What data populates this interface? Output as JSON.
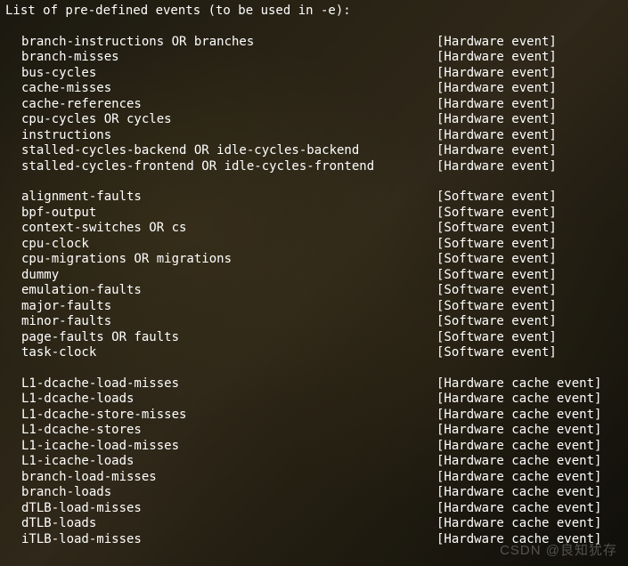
{
  "header": "List of pre-defined events (to be used in -e):",
  "groups": [
    {
      "type_label": "[Hardware event]",
      "events": [
        "branch-instructions OR branches",
        "branch-misses",
        "bus-cycles",
        "cache-misses",
        "cache-references",
        "cpu-cycles OR cycles",
        "instructions",
        "stalled-cycles-backend OR idle-cycles-backend",
        "stalled-cycles-frontend OR idle-cycles-frontend"
      ]
    },
    {
      "type_label": "[Software event]",
      "events": [
        "alignment-faults",
        "bpf-output",
        "context-switches OR cs",
        "cpu-clock",
        "cpu-migrations OR migrations",
        "dummy",
        "emulation-faults",
        "major-faults",
        "minor-faults",
        "page-faults OR faults",
        "task-clock"
      ]
    },
    {
      "type_label": "[Hardware cache event]",
      "events": [
        "L1-dcache-load-misses",
        "L1-dcache-loads",
        "L1-dcache-store-misses",
        "L1-dcache-stores",
        "L1-icache-load-misses",
        "L1-icache-loads",
        "branch-load-misses",
        "branch-loads",
        "dTLB-load-misses",
        "dTLB-loads",
        "iTLB-load-misses"
      ]
    }
  ],
  "watermark": "CSDN @良知犹存"
}
